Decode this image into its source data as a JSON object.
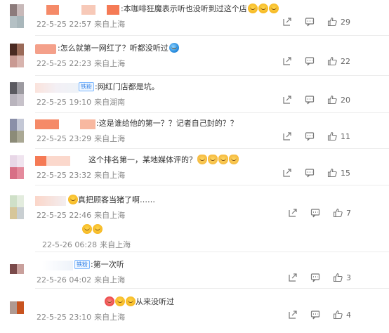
{
  "comments": [
    {
      "text": ":本咖啡狂魔表示听也没听到过这个店",
      "emojis": [
        "smug",
        "smug",
        "smug"
      ],
      "time": "22-5-25 22:57",
      "location": "来自上海",
      "likes": "29",
      "tag": ""
    },
    {
      "text": ":怎么就第一网红了？听都没听过",
      "emojis": [
        "blue"
      ],
      "time": "22-5-25 22:23",
      "location": "来自上海",
      "likes": "22",
      "tag": ""
    },
    {
      "text": ":网红门店都是坑。",
      "emojis": [],
      "time": "22-5-25 19:10",
      "location": "来自湖南",
      "likes": "20",
      "tag": "铁粉"
    },
    {
      "text": ":这是谁给他的第一？？记者自己封的？？",
      "emojis": [],
      "time": "22-5-25 23:29",
      "location": "来自上海",
      "likes": "11",
      "tag": ""
    },
    {
      "text": "这个排名第一，某地媒体评的？",
      "emojis": [
        "cat",
        "cat",
        "cat",
        "cat"
      ],
      "time": "22-5-25 23:32",
      "location": "来自上海",
      "likes": "15",
      "tag": ""
    },
    {
      "text": "真把顾客当猪了啊……",
      "emojis": [
        "smug"
      ],
      "time": "22-5-25 22:46",
      "location": "来自上海",
      "likes": "7",
      "tag": ""
    },
    {
      "text": "",
      "emojis": [
        "smug",
        "smug"
      ],
      "time": "22-5-26 06:28",
      "location": "来自上海",
      "likes": "",
      "tag": ""
    },
    {
      "text": ":第一次听",
      "emojis": [],
      "time": "22-5-26 04:02",
      "location": "来自上海",
      "likes": "3",
      "tag": "铁粉"
    },
    {
      "text": "从来没听过",
      "emojis": [
        "heart",
        "smug",
        "smug"
      ],
      "time": "22-5-25 23:10",
      "location": "来自上海",
      "likes": "4",
      "tag": ""
    }
  ],
  "icons": {
    "share": "share-icon",
    "reply": "comment-icon",
    "like": "thumbs-up-icon"
  }
}
